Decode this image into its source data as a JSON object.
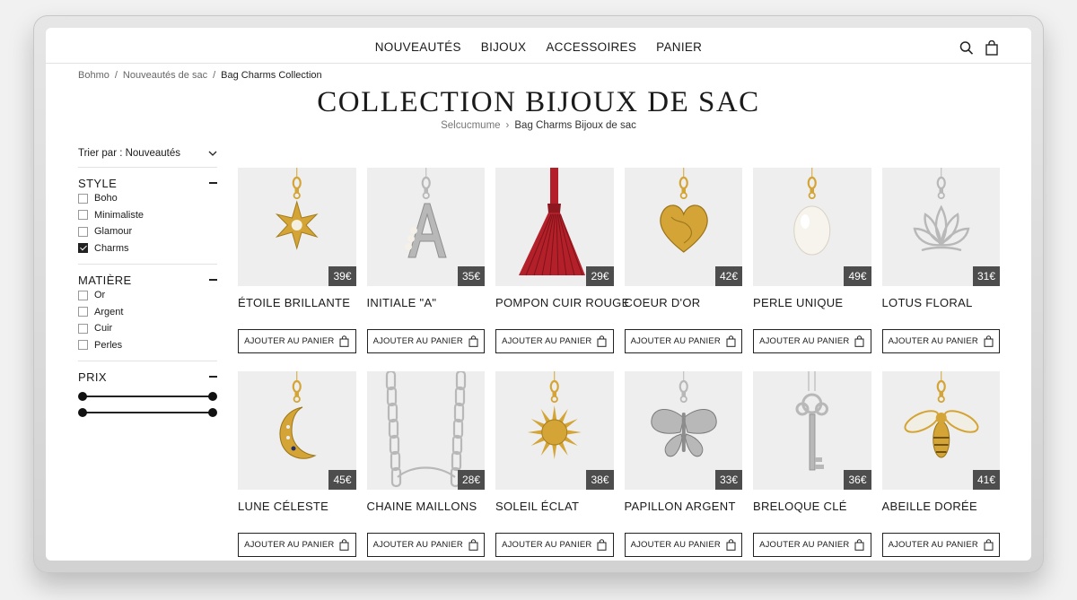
{
  "nav": {
    "links": [
      "NOUVEAUTÉS",
      "BIJOUX",
      "ACCESSOIRES",
      "PANIER"
    ],
    "icons": [
      "search-icon",
      "bag-icon"
    ]
  },
  "breadcrumb": {
    "items": [
      "Bohmo",
      "Nouveautés de sac",
      "Bag Charms Collection"
    ],
    "separator": "/"
  },
  "page": {
    "title": "COLLECTION BIJOUX DE SAC",
    "subcrumb_1": "Selcucmume",
    "subcrumb_2": "Bag Charms Bijoux de sac"
  },
  "sidebar": {
    "sort_label": "Trier par : Nouveautés",
    "style": {
      "title": "STYLE",
      "options": [
        {
          "label": "Boho",
          "checked": false
        },
        {
          "label": "Minimaliste",
          "checked": false
        },
        {
          "label": "Glamour",
          "checked": false
        },
        {
          "label": "Charms",
          "checked": true
        }
      ]
    },
    "matiere": {
      "title": "MATIÈRE",
      "options": [
        {
          "label": "Or",
          "checked": false
        },
        {
          "label": "Argent",
          "checked": false
        },
        {
          "label": "Cuir",
          "checked": false
        },
        {
          "label": "Perles",
          "checked": false
        }
      ]
    },
    "prix": {
      "title": "PRIX",
      "range_1": [
        0,
        1
      ],
      "range_2": [
        0,
        1
      ]
    }
  },
  "colors": {
    "gold": "#d4a536",
    "silver": "#b8b8b8",
    "red": "#b3202a",
    "price_badge": "#4d4d4d"
  },
  "products": [
    {
      "name": "ÉTOILE BRILLANTE",
      "price": "39€",
      "button": "AJOUTER AU PANIER",
      "icon": "star-charm",
      "metal": "gold"
    },
    {
      "name": "INITIALE \"A\"",
      "price": "35€",
      "button": "AJOUTER AU PANIER",
      "icon": "letter-a-charm",
      "metal": "silver"
    },
    {
      "name": "POMPON CUIR ROUGE",
      "price": "29€",
      "button": "AJOUTER AU PANIER",
      "icon": "tassel-charm",
      "metal": "red"
    },
    {
      "name": "COEUR D'OR",
      "price": "42€",
      "button": "AJOUTER AU PANIER",
      "icon": "heart-charm",
      "metal": "gold"
    },
    {
      "name": "PERLE UNIQUE",
      "price": "49€",
      "button": "AJOUTER AU PANIER",
      "icon": "pearl-charm",
      "metal": "gold"
    },
    {
      "name": "LOTUS FLORAL",
      "price": "31€",
      "button": "AJOUTER AU PANIER",
      "icon": "lotus-charm",
      "metal": "silver"
    },
    {
      "name": "LUNE CÉLESTE",
      "price": "45€",
      "button": "AJOUTER AU PANIER",
      "icon": "moon-charm",
      "metal": "gold"
    },
    {
      "name": "CHAINE MAILLONS",
      "price": "28€",
      "button": "AJOUTER AU PANIER",
      "icon": "chain-charm",
      "metal": "silver"
    },
    {
      "name": "SOLEIL ÉCLAT",
      "price": "38€",
      "button": "AJOUTER AU PANIER",
      "icon": "sun-charm",
      "metal": "gold"
    },
    {
      "name": "PAPILLON ARGENT",
      "price": "33€",
      "button": "AJOUTER AU PANIER",
      "icon": "butterfly-charm",
      "metal": "silver"
    },
    {
      "name": "BRELOQUE CLÉ",
      "price": "36€",
      "button": "AJOUTER AU PANIER",
      "icon": "key-charm",
      "metal": "silver"
    },
    {
      "name": "ABEILLE DORÉE",
      "price": "41€",
      "button": "AJOUTER AU PANIER",
      "icon": "bee-charm",
      "metal": "gold"
    }
  ]
}
